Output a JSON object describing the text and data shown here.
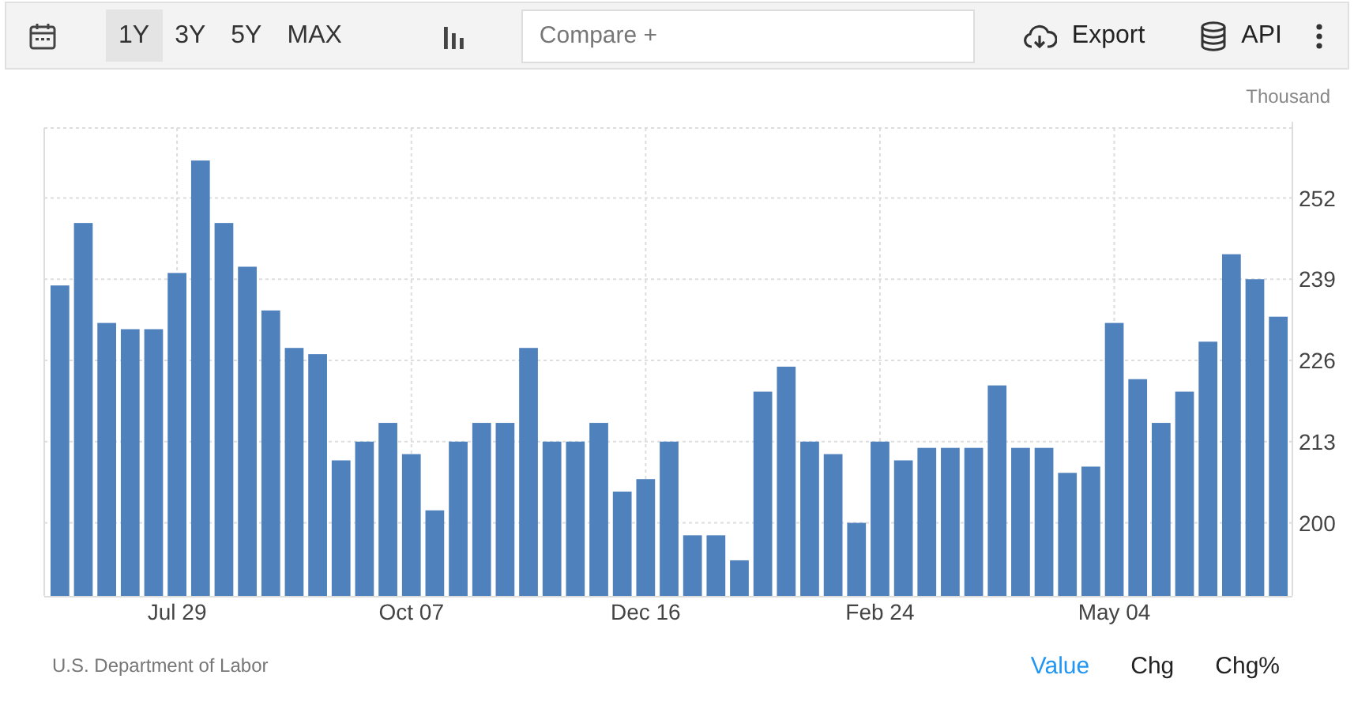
{
  "toolbar": {
    "ranges": [
      {
        "label": "1Y",
        "selected": true
      },
      {
        "label": "3Y",
        "selected": false
      },
      {
        "label": "5Y",
        "selected": false
      },
      {
        "label": "MAX",
        "selected": false
      }
    ],
    "compare": {
      "placeholder": "Compare +"
    },
    "actions": [
      {
        "label": "Export",
        "kind": "export"
      },
      {
        "label": "API",
        "kind": "api"
      }
    ]
  },
  "chart": {
    "unit": "Thousand",
    "chart_data": {
      "type": "bar",
      "orientation": "vertical",
      "grid": true,
      "categories": [
        null,
        null,
        null,
        null,
        null,
        "Jul 29",
        null,
        null,
        null,
        null,
        null,
        null,
        null,
        null,
        null,
        "Oct 07",
        null,
        null,
        null,
        null,
        null,
        null,
        null,
        null,
        null,
        "Dec 16",
        null,
        null,
        null,
        null,
        null,
        null,
        null,
        null,
        null,
        "Feb 24",
        null,
        null,
        null,
        null,
        null,
        null,
        null,
        null,
        null,
        "May 04",
        null,
        null,
        null,
        null,
        null,
        null,
        null
      ],
      "series": [
        {
          "color": "#4f81bd",
          "values": [
            238,
            248,
            232,
            231,
            231,
            240,
            258,
            248,
            241,
            234,
            228,
            227,
            210,
            213,
            216,
            211,
            202,
            213,
            216,
            216,
            228,
            213,
            213,
            216,
            205,
            207,
            213,
            198,
            198,
            194,
            221,
            225,
            213,
            211,
            200,
            213,
            210,
            212,
            212,
            212,
            222,
            212,
            212,
            208,
            209,
            232,
            223,
            216,
            221,
            229,
            243,
            239,
            233
          ]
        }
      ],
      "ylim": [
        188.3,
        263.2
      ],
      "yticks": [
        200,
        213,
        226,
        239,
        252
      ]
    }
  },
  "footer": {
    "source": "U.S. Department of Labor",
    "views": [
      {
        "label": "Value",
        "selected": true
      },
      {
        "label": "Chg",
        "selected": false
      },
      {
        "label": "Chg%",
        "selected": false
      }
    ]
  }
}
